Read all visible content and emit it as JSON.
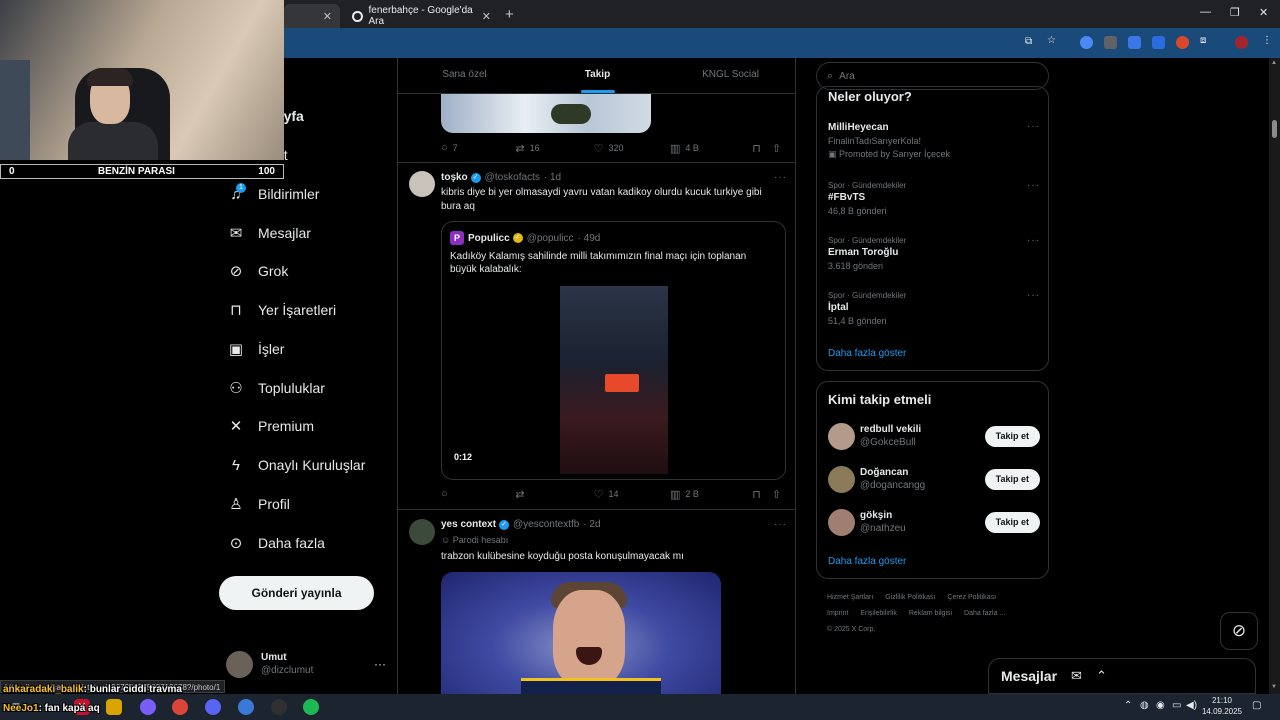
{
  "browser": {
    "tabs": [
      {
        "title": "",
        "active": true
      },
      {
        "title": "fenerbahçe - Google'da Ara",
        "active": false
      }
    ],
    "new_tab": "+",
    "close_glyph": "✕"
  },
  "webcam": {
    "bar_left": "0",
    "bar_label": "BENZİN PARASI",
    "bar_right": "100"
  },
  "nav": {
    "partial_home": "sayfa",
    "partial_explore": "et",
    "notif_count": "1",
    "items": [
      {
        "label": "Bildirimler",
        "icon": "bell-icon"
      },
      {
        "label": "Mesajlar",
        "icon": "envelope-icon"
      },
      {
        "label": "Grok",
        "icon": "grok-icon"
      },
      {
        "label": "Yer İşaretleri",
        "icon": "bookmark-icon"
      },
      {
        "label": "İşler",
        "icon": "briefcase-icon"
      },
      {
        "label": "Topluluklar",
        "icon": "people-icon"
      },
      {
        "label": "Premium",
        "icon": "x-logo-icon"
      },
      {
        "label": "Onaylı Kuruluşlar",
        "icon": "lightning-icon"
      },
      {
        "label": "Profil",
        "icon": "person-icon"
      },
      {
        "label": "Daha fazla",
        "icon": "more-circle-icon"
      }
    ],
    "post_button": "Gönderi yayınla"
  },
  "account": {
    "display_name": "Umut",
    "handle": "@dizclumut",
    "more": "···"
  },
  "feed_tabs": [
    {
      "label": "Sana özel",
      "active": false
    },
    {
      "label": "Takip",
      "active": true
    },
    {
      "label": "KNGL Social",
      "active": false
    }
  ],
  "tweet1_actions": {
    "replies": "7",
    "reposts": "16",
    "likes": "320",
    "views": "4 B"
  },
  "tweet2": {
    "display_name": "toşko",
    "handle": "@toskofacts",
    "time": "· 1d",
    "text": "kibris diye bi yer olmasaydi yavru vatan kadikoy olurdu kucuk turkiye gibi bura aq",
    "quote": {
      "display_name": "Populicc",
      "handle": "@populicc",
      "time": "· 49d",
      "avatar_letter": "P",
      "text": "Kadıköy Kalamış sahilinde milli takımımızın final maçı için toplanan büyük kalabalık:",
      "video_time": "0:12"
    },
    "actions": {
      "replies": "",
      "reposts": "",
      "likes": "14",
      "views": "2 B"
    }
  },
  "tweet3": {
    "display_name": "yes context",
    "handle": "@yescontextfb",
    "time": "· 2d",
    "parody_label": "Parodi hesabı",
    "text": "trabzon kulübesine koyduğu posta konuşulmayacak mı"
  },
  "search": {
    "placeholder": "Ara"
  },
  "trends": {
    "title": "Neler oluyor?",
    "items": [
      {
        "category": "",
        "name": "MilliHeyecan",
        "sub": "FinalinTadıSarıyerKola!",
        "promo": "Promoted by Sarıyer İçecek"
      },
      {
        "category": "Spor · Gündemdekiler",
        "name": "#FBvTS",
        "sub": "46,8 B gönderi"
      },
      {
        "category": "Spor · Gündemdekiler",
        "name": "Erman Toroğlu",
        "sub": "3.618 gönderi"
      },
      {
        "category": "Spor · Gündemdekiler",
        "name": "İptal",
        "sub": "51,4 B gönderi"
      }
    ],
    "show_more": "Daha fazla göster"
  },
  "who_to_follow": {
    "title": "Kimi takip etmeli",
    "items": [
      {
        "display_name": "redbull vekili",
        "handle": "@GokceBull",
        "button": "Takip et"
      },
      {
        "display_name": "Doğancan",
        "handle": "@dogancangg",
        "button": "Takip et"
      },
      {
        "display_name": "gökşin",
        "handle": "@nathzeu",
        "button": "Takip et"
      }
    ],
    "show_more": "Daha fazla göster"
  },
  "footer": {
    "links": [
      "Hizmet Şartları",
      "Gizlilik Politikası",
      "Çerez Politikası",
      "Imprint",
      "Erişilebilirlik",
      "Reklam bilgisi",
      "Daha fazla ..."
    ],
    "copyright": "© 2025 X Corp."
  },
  "messages_drawer": {
    "label": "Mesajlar"
  },
  "status_url": "https://x.com/calamur/status/196729957583719678?/photo/1",
  "chat": [
    {
      "user": "ankaradaki_balik",
      "msg": ": bunlar ciddi travma"
    },
    {
      "user": "NeeJo1",
      "msg": ": fan kapa aq"
    }
  ],
  "clock": {
    "time": "21:10",
    "date": "14.09.2025"
  },
  "colors": {
    "accent": "#1d9bf0",
    "bg": "#000000",
    "border": "#2f3336",
    "muted": "#71767b"
  }
}
